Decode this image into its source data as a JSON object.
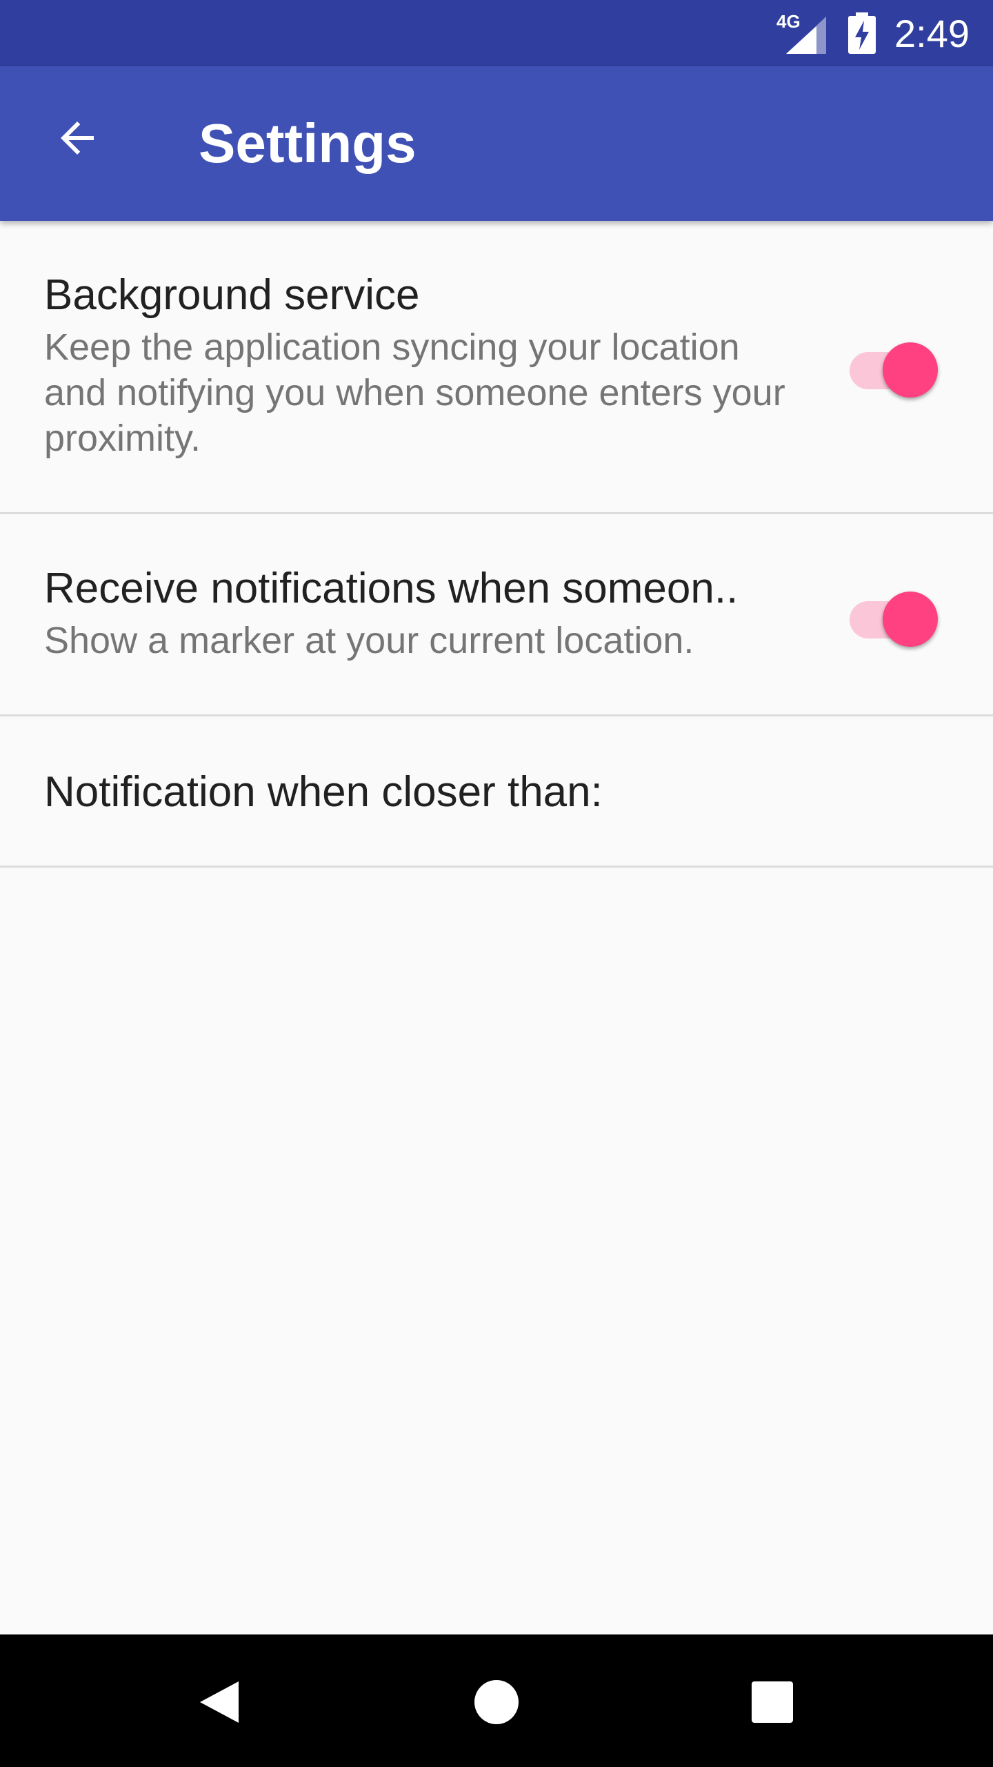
{
  "status_bar": {
    "network": "4G",
    "time": "2:49",
    "signal_icon": "signal-icon",
    "battery_icon": "battery-charging-icon"
  },
  "app_bar": {
    "back_icon": "arrow-back-icon",
    "title": "Settings",
    "color": "#3f51b5"
  },
  "preferences": [
    {
      "title": "Background service",
      "summary": "Keep the application syncing your location and notifying you when someone enters your proximity.",
      "switch_on": true
    },
    {
      "title": "Receive notifications when someon..",
      "summary": "Show a marker at your current location.",
      "switch_on": true
    },
    {
      "title": "Notification when closer than:"
    }
  ],
  "accent_color": "#ff4081",
  "nav_bar": {
    "back_icon": "nav-back-icon",
    "home_icon": "nav-home-icon",
    "recents_icon": "nav-recents-icon"
  }
}
